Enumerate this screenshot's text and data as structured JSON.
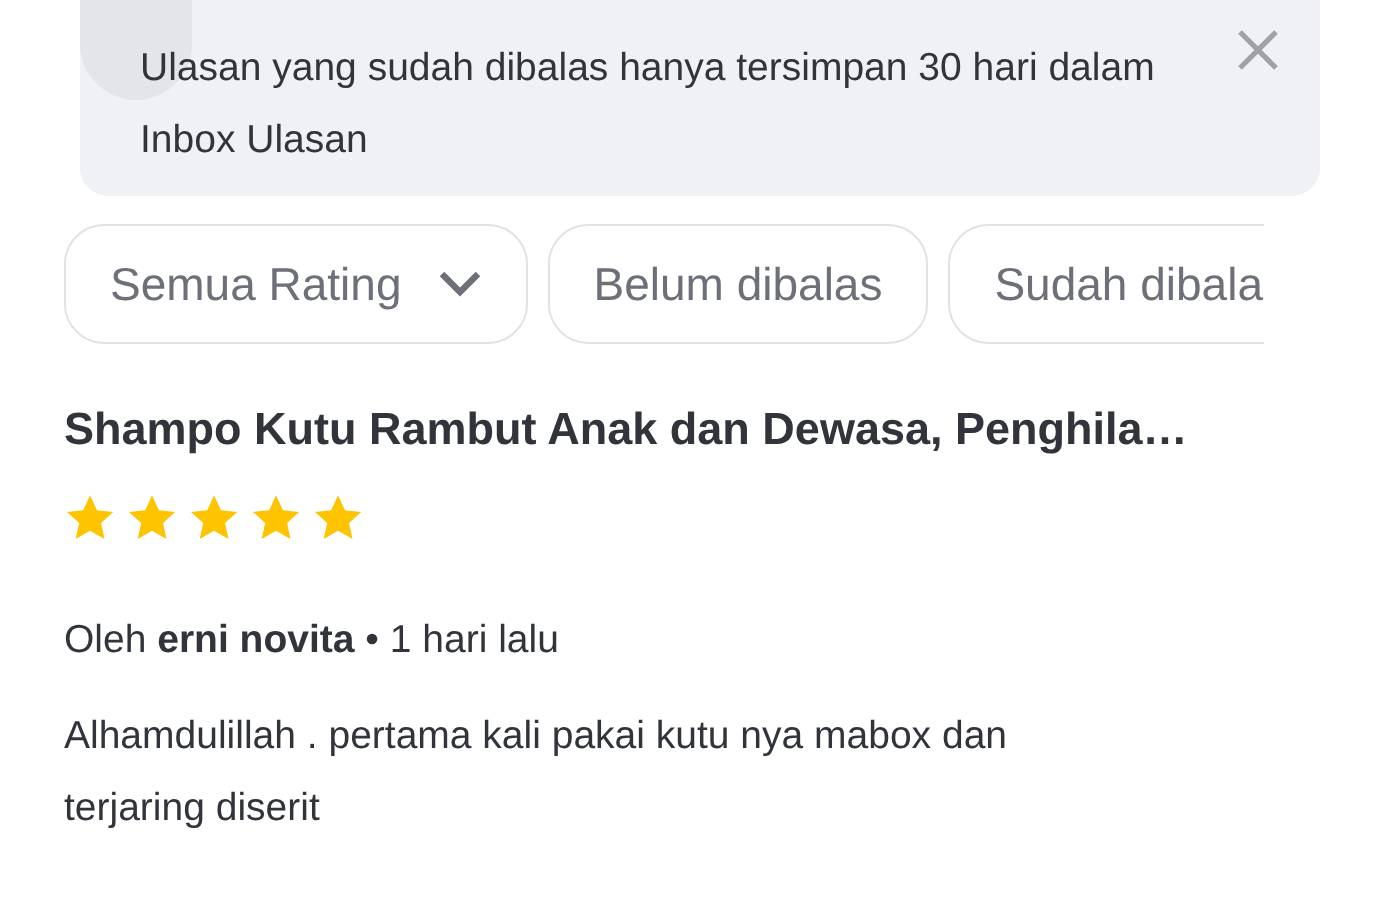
{
  "notice": {
    "text": "Ulasan yang sudah dibalas hanya tersimpan 30 hari dalam Inbox Ulasan"
  },
  "filters": [
    {
      "label": "Semua Rating",
      "kind": "dropdown"
    },
    {
      "label": "Belum dibalas",
      "kind": "chip"
    },
    {
      "label": "Sudah dibala",
      "kind": "chip"
    }
  ],
  "review": {
    "product": "Shampo Kutu Rambut Anak dan Dewasa, Penghila…",
    "stars": 5,
    "by_label": "Oleh",
    "author": "erni novita",
    "separator": "•",
    "time": "1 hari lalu",
    "text": "Alhamdulillah . pertama kali pakai kutu nya mabox dan terjaring diserit"
  }
}
